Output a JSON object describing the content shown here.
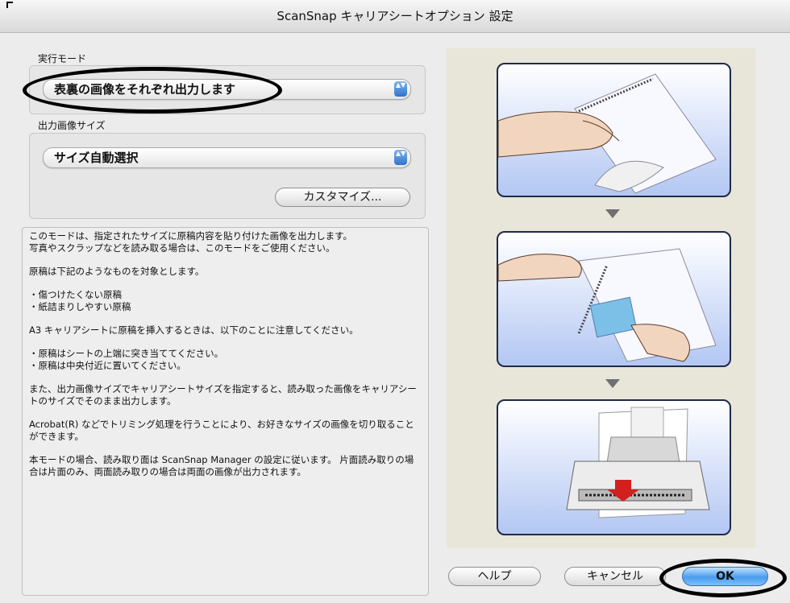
{
  "window": {
    "title": "ScanSnap キャリアシートオプション 設定"
  },
  "mode": {
    "label": "実行モード",
    "selected": "表裏の画像をそれぞれ出力します",
    "popup_arrows": "▲▼"
  },
  "output_size": {
    "label": "出力画像サイズ",
    "selected": "サイズ自動選択",
    "popup_arrows": "▲▼",
    "customize_label": "カスタマイズ..."
  },
  "description": {
    "paragraphs": [
      "このモードは、指定されたサイズに原稿内容を貼り付けた画像を出力します。\n写真やスクラップなどを読み取る場合は、このモードをご使用ください。",
      "原稿は下記のようなものを対象とします。",
      "・傷つけたくない原稿\n・紙詰まりしやすい原稿",
      "A3 キャリアシートに原稿を挿入するときは、以下のことに注意してください。",
      "・原稿はシートの上端に突き当ててください。\n・原稿は中央付近に置いてください。",
      "また、出力画像サイズでキャリアシートサイズを指定すると、読み取った画像をキャリアシートのサイズでそのまま出力します。",
      "Acrobat(R) などでトリミング処理を行うことにより、お好きなサイズの画像を切り取ることができます。",
      "本モードの場合、読み取り面は ScanSnap Manager の設定に従います。 片面読み取りの場合は片面のみ、両面読み取りの場合は両面の画像が出力されます。"
    ]
  },
  "buttons": {
    "help": "ヘルプ",
    "cancel": "キャンセル",
    "ok": "OK"
  },
  "colors": {
    "window_bg": "#ececec",
    "panel_border": "#1f2a4a",
    "ok_accent": "#4a9ded",
    "popup_arrow_accent": "#2f73cc",
    "illustration_bg": "#e8e6d8"
  }
}
